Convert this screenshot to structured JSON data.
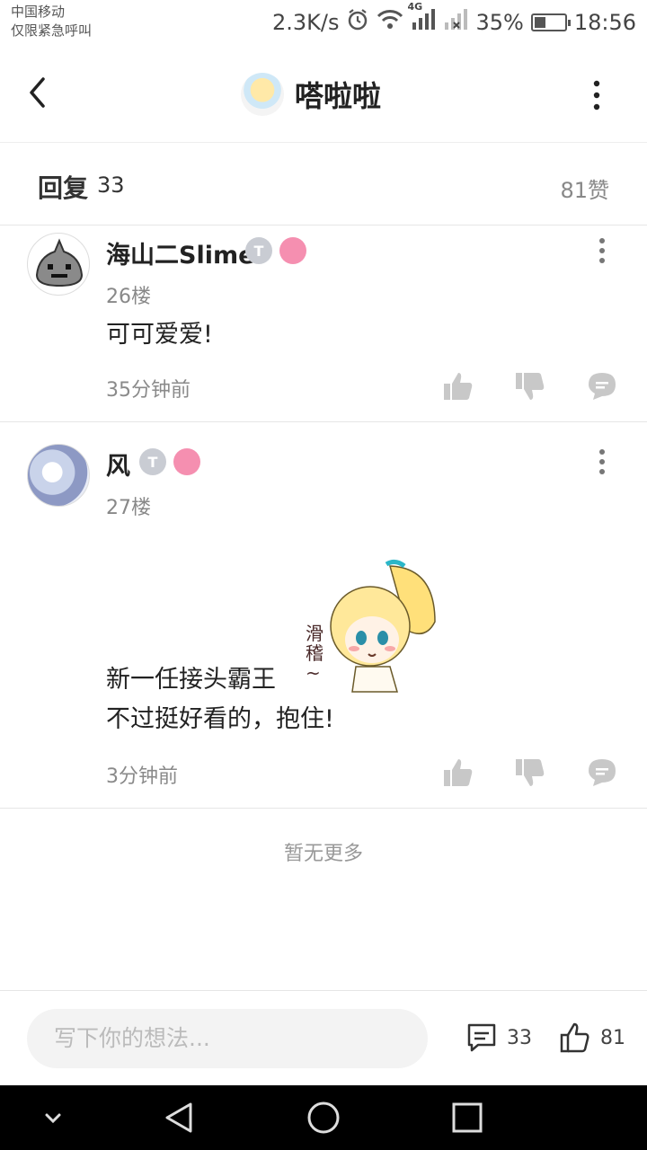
{
  "status": {
    "carrier_line1": "中国移动",
    "carrier_line2": "仅限紧急呼叫",
    "speed": "2.3K/s",
    "network": "4G",
    "battery": "35%",
    "battery_level": 0.35,
    "time": "18:56"
  },
  "header": {
    "title": "嗒啦啦"
  },
  "replies": {
    "label": "回复",
    "count": "33",
    "likes": "81赞"
  },
  "comments": [
    {
      "username": "海山二Slime",
      "floor": "26楼",
      "lines": [
        "可可爱爱!"
      ],
      "time": "35分钟前"
    },
    {
      "username": "风",
      "floor": "27楼",
      "sticker_text": "滑稽~",
      "lines": [
        "新一任接头霸王",
        "不过挺好看的，抱住!"
      ],
      "time": "3分钟前"
    }
  ],
  "footer": {
    "no_more": "暂无更多",
    "placeholder": "写下你的想法...",
    "comment_count": "33",
    "like_count": "81"
  },
  "colors": {
    "icon_gray": "#c8c8c8",
    "badge_pink": "#f58fb0",
    "badge_silver": "#c9ccd3"
  }
}
